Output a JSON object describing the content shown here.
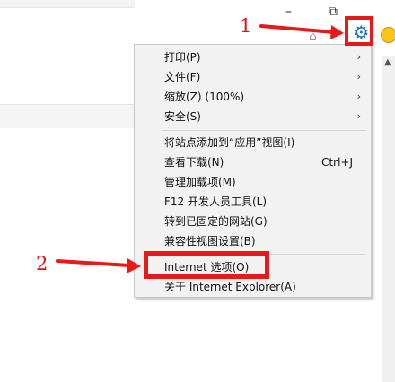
{
  "window": {
    "minimize_glyph": "–",
    "restore_glyph": "⧉"
  },
  "toolbar": {
    "home_icon": "home-icon",
    "favorites_icon": "star-icon",
    "tools_icon": "gear-icon",
    "feedback_icon": "smiley-icon"
  },
  "annotations": {
    "step1": "1",
    "step2": "2",
    "highlight_color": "#e51a1a"
  },
  "menu": {
    "items": [
      {
        "label": "打印(P)",
        "arrow": "›",
        "shortcut": ""
      },
      {
        "label": "文件(F)",
        "arrow": "›",
        "shortcut": ""
      },
      {
        "label": "缩放(Z) (100%)",
        "arrow": "›",
        "shortcut": ""
      },
      {
        "label": "安全(S)",
        "arrow": "›",
        "shortcut": ""
      },
      {
        "label": "将站点添加到“应用”视图(I)",
        "arrow": "",
        "shortcut": ""
      },
      {
        "label": "查看下载(N)",
        "arrow": "",
        "shortcut": "Ctrl+J"
      },
      {
        "label": "管理加载项(M)",
        "arrow": "",
        "shortcut": ""
      },
      {
        "label": "F12 开发人员工具(L)",
        "arrow": "",
        "shortcut": ""
      },
      {
        "label": "转到已固定的网站(G)",
        "arrow": "",
        "shortcut": ""
      },
      {
        "label": "兼容性视图设置(B)",
        "arrow": "",
        "shortcut": ""
      },
      {
        "label": "Internet 选项(O)",
        "arrow": "",
        "shortcut": ""
      },
      {
        "label": "关于 Internet Explorer(A)",
        "arrow": "",
        "shortcut": ""
      }
    ]
  }
}
